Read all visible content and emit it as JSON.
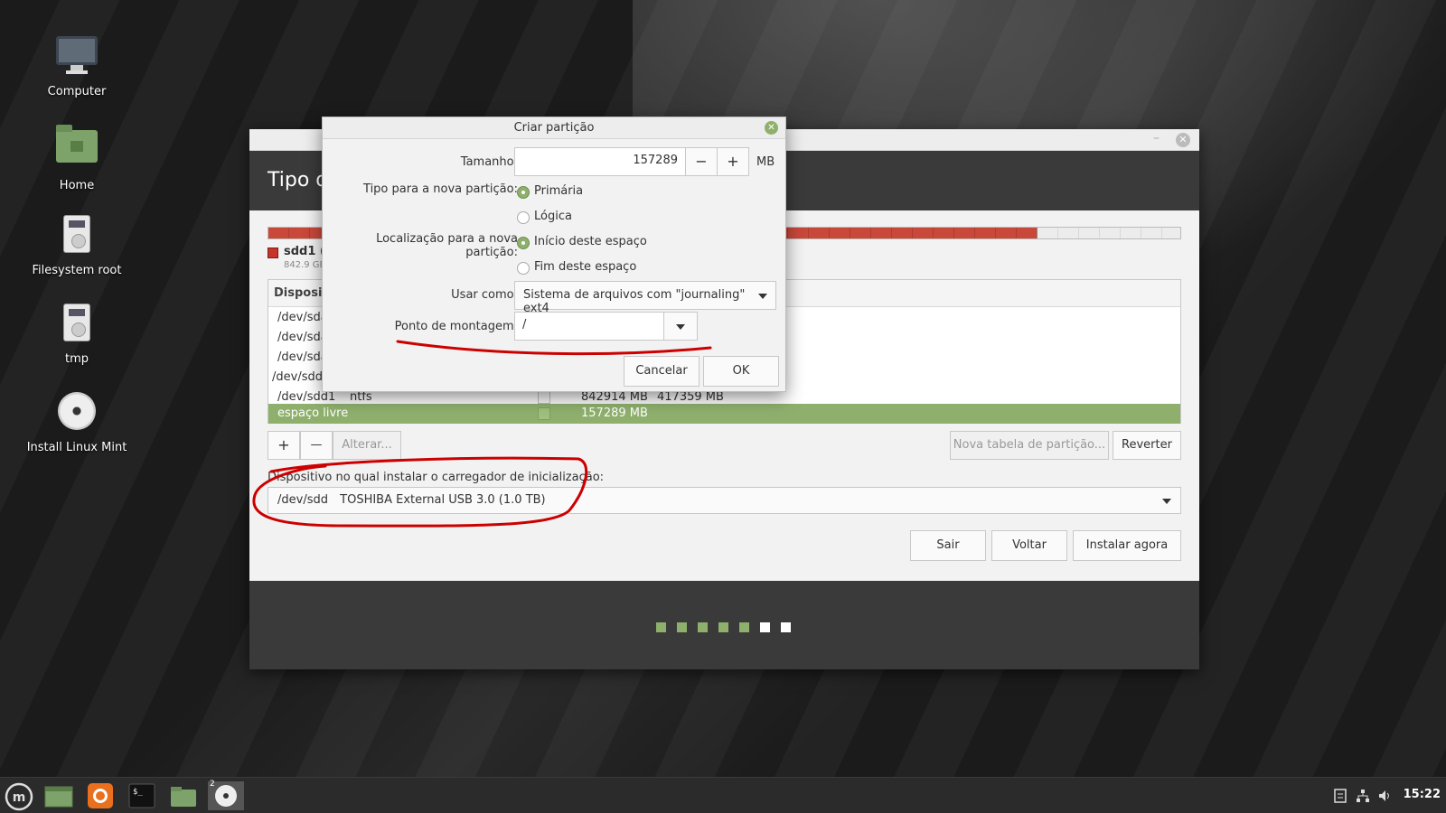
{
  "desktop": {
    "icons": [
      {
        "label": "Computer",
        "icon": "computer-icon"
      },
      {
        "label": "Home",
        "icon": "home-folder-icon"
      },
      {
        "label": "Filesystem root",
        "icon": "drive-icon"
      },
      {
        "label": "tmp",
        "icon": "drive-icon"
      },
      {
        "label": "Install Linux Mint",
        "icon": "disc-icon"
      }
    ]
  },
  "installer": {
    "header_title": "Tipo d",
    "partition_legend": {
      "name": "sdd1 (n",
      "size": "842.9 GB"
    },
    "table": {
      "header": "Disposit",
      "rows": [
        {
          "device": "/dev/sda",
          "type": "",
          "size": "",
          "used": ""
        },
        {
          "device": "/dev/sda",
          "type": "",
          "size": "",
          "used": ""
        },
        {
          "device": "/dev/sda",
          "type": "",
          "size": "",
          "used": ""
        },
        {
          "device": "/dev/sdd",
          "type": "",
          "size": "",
          "used": ""
        },
        {
          "device": "/dev/sdd1",
          "type": "ntfs",
          "size": "842914 MB",
          "used": "417359 MB"
        },
        {
          "device": "espaço livre",
          "type": "",
          "size": "157289 MB",
          "used": ""
        }
      ]
    },
    "buttons": {
      "add": "+",
      "remove": "—",
      "change": "Alterar...",
      "new_table": "Nova tabela de partição...",
      "revert": "Reverter",
      "quit": "Sair",
      "back": "Voltar",
      "install_now": "Instalar agora"
    },
    "bootloader": {
      "label": "Dispositivo no qual instalar o carregador de inicialização:",
      "device": "/dev/sdd",
      "description": "TOSHIBA External USB 3.0 (1.0 TB)"
    },
    "progress": {
      "total_steps": 7,
      "completed_steps": 5
    }
  },
  "dialog": {
    "title": "Criar partição",
    "size_label": "Tamanho:",
    "size_value": "157289",
    "size_unit": "MB",
    "minus": "−",
    "plus": "+",
    "type_label": "Tipo para a nova partição:",
    "type_primary": "Primária",
    "type_logical": "Lógica",
    "location_label": "Localização para a nova partição:",
    "location_start": "Início deste espaço",
    "location_end": "Fim deste espaço",
    "use_as_label": "Usar como:",
    "use_as_value": "Sistema de arquivos com \"journaling\" ext4",
    "mount_label": "Ponto de montagem:",
    "mount_value": "/",
    "cancel": "Cancelar",
    "ok": "OK"
  },
  "taskbar": {
    "clock": "15:22",
    "workspace_badge": "2"
  },
  "colors": {
    "accent": "#8fb06d",
    "partition_used": "#c8483a",
    "annotation": "#cc0000",
    "header_bg": "#3a3a3a"
  }
}
